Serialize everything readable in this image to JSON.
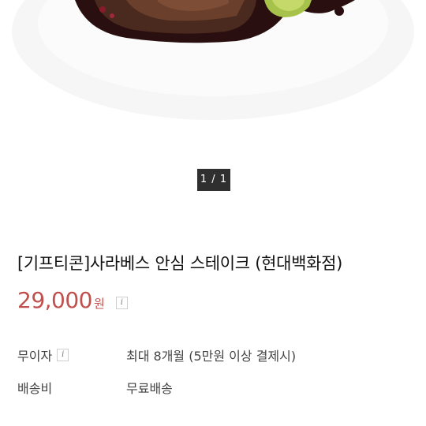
{
  "gallery": {
    "counter": "1 / 1"
  },
  "product": {
    "title": "[기프티콘]사라베스 안심 스테이크 (현대백화점)",
    "price": "29,000",
    "currency_unit": "원",
    "info_icon": "i"
  },
  "details": [
    {
      "label": "무이자",
      "value": "최대 8개월 (5만원 이상 결제시)",
      "has_info": true
    },
    {
      "label": "배송비",
      "value": "무료배송",
      "has_info": false
    }
  ],
  "colors": {
    "price": "#c0504d",
    "counter_bg": "#2f2f2f"
  }
}
